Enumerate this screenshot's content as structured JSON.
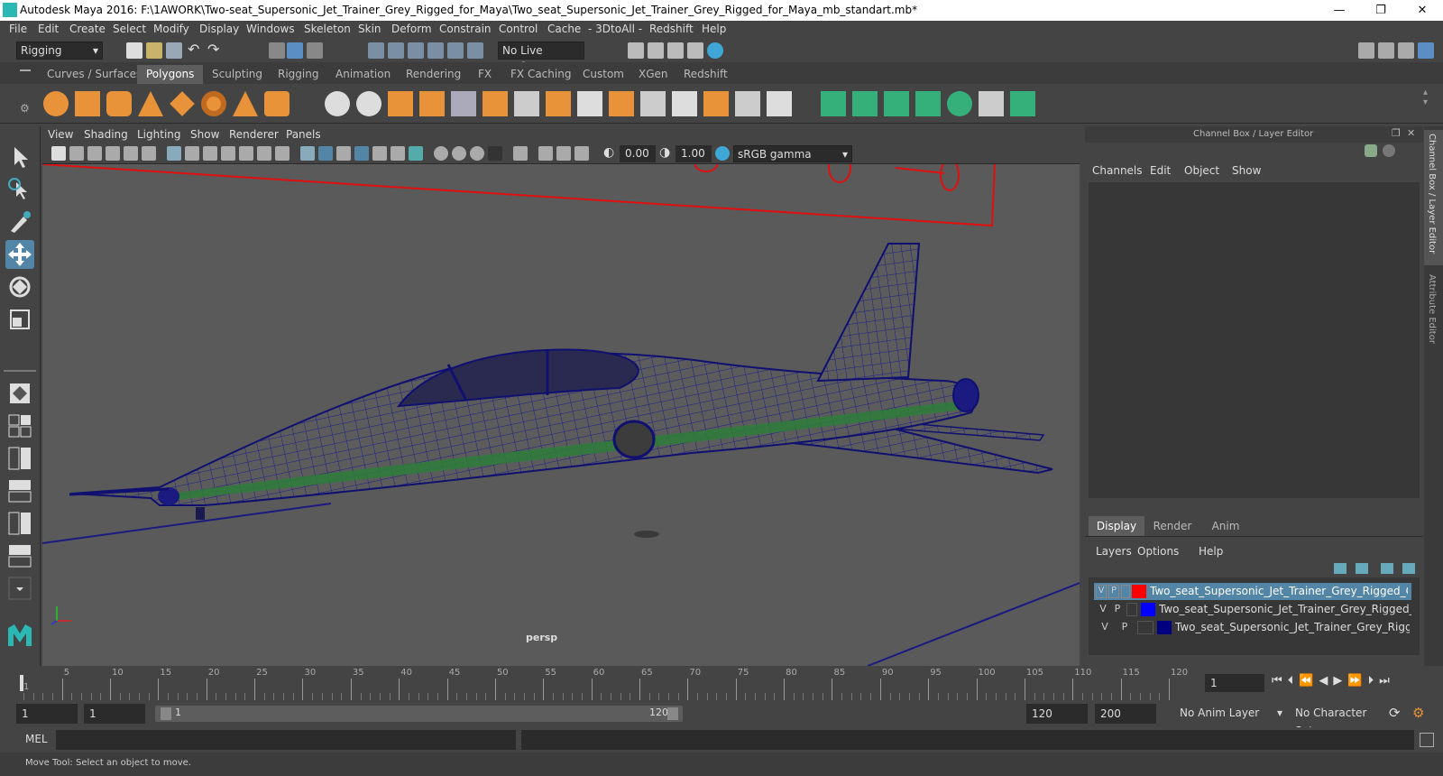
{
  "window": {
    "title": "Autodesk Maya 2016: F:\\1AWORK\\Two-seat_Supersonic_Jet_Trainer_Grey_Rigged_for_Maya\\Two_seat_Supersonic_Jet_Trainer_Grey_Rigged_for_Maya_mb_standart.mb*",
    "minimize": "—",
    "restore": "❐",
    "close": "✕"
  },
  "menus": [
    "File",
    "Edit",
    "Create",
    "Select",
    "Modify",
    "Display",
    "Windows",
    "Skeleton",
    "Skin",
    "Deform",
    "Constrain",
    "Control",
    "Cache",
    "- 3DtoAll -",
    "Redshift",
    "Help"
  ],
  "status": {
    "mode": "Rigging",
    "live_surface": "No Live Surface"
  },
  "shelf_tabs": [
    "Curves / Surfaces",
    "Polygons",
    "Sculpting",
    "Rigging",
    "Animation",
    "Rendering",
    "FX",
    "FX Caching",
    "Custom",
    "XGen",
    "Redshift"
  ],
  "shelf_active": "Polygons",
  "viewport": {
    "menus": [
      "View",
      "Shading",
      "Lighting",
      "Show",
      "Renderer",
      "Panels"
    ],
    "exposure": "0.00",
    "gamma": "1.00",
    "colorspace": "sRGB gamma",
    "camera_label": "persp"
  },
  "channel_box": {
    "title": "Channel Box / Layer Editor",
    "menus": [
      "Channels",
      "Edit",
      "Object",
      "Show"
    ]
  },
  "layer_editor": {
    "tabs": [
      "Display",
      "Render",
      "Anim"
    ],
    "menus": [
      "Layers",
      "Options",
      "Help"
    ],
    "layers": [
      {
        "v": "V",
        "p": "P",
        "color": "#ff0000",
        "name": "Two_seat_Supersonic_Jet_Trainer_Grey_Rigged_Controllers"
      },
      {
        "v": "V",
        "p": "P",
        "color": "#0000ff",
        "name": "Two_seat_Supersonic_Jet_Trainer_Grey_Rigged_Bones"
      },
      {
        "v": "V",
        "p": "P",
        "color": "#000080",
        "name": "Two_seat_Supersonic_Jet_Trainer_Grey_Rigged"
      }
    ]
  },
  "side_tabs": [
    "Channel Box / Layer Editor",
    "Attribute Editor"
  ],
  "timeline": {
    "ticks": [
      "5",
      "10",
      "15",
      "20",
      "25",
      "30",
      "35",
      "40",
      "45",
      "50",
      "55",
      "60",
      "65",
      "70",
      "75",
      "80",
      "85",
      "90",
      "95",
      "100",
      "105",
      "110",
      "115",
      "120"
    ],
    "start_marker": "1",
    "current_frame": "1"
  },
  "range": {
    "start": "1",
    "playback_start": "1",
    "slider_start": "1",
    "slider_end": "120",
    "playback_end": "120",
    "end": "200",
    "anim_layer": "No Anim Layer",
    "character_set": "No Character Set"
  },
  "command": {
    "language": "MEL"
  },
  "help_line": "Move Tool: Select an object to move."
}
